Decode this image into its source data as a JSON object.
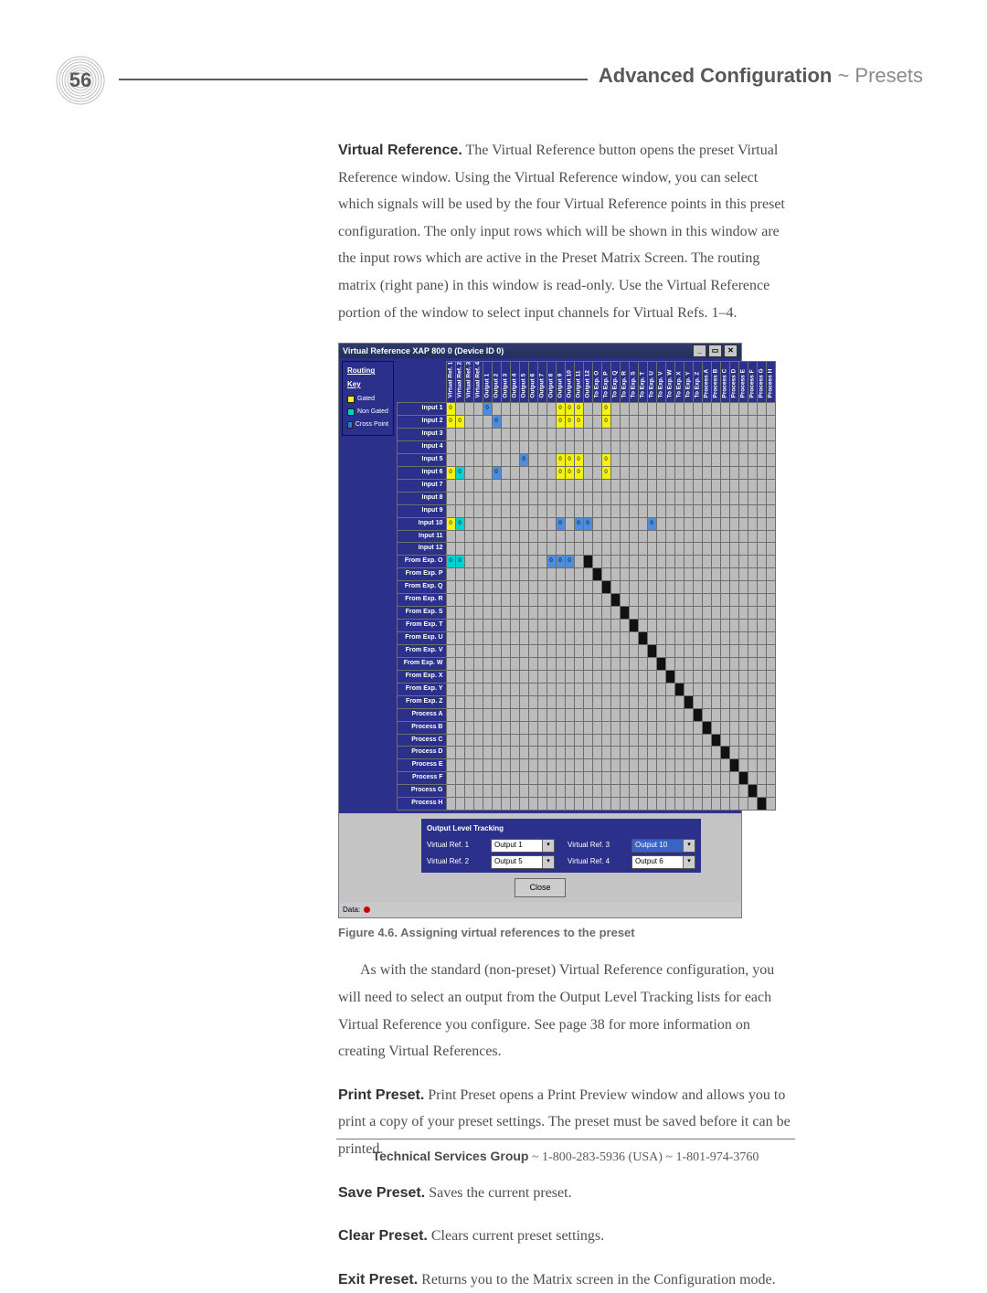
{
  "pageNumber": "56",
  "header": {
    "strong": "Advanced Configuration",
    "sep": " ~ ",
    "light": "Presets"
  },
  "p1": {
    "lead": "Virtual Reference.",
    "text": " The Virtual Reference button opens the preset Virtual Reference window. Using the Virtual Reference window, you can select which signals will be used by the four Virtual Reference points in this preset configuration. The only input rows which will be shown in this window are the input rows which are active in the Preset Matrix Screen. The routing matrix (right pane) in this window is read-only. Use the Virtual Reference portion of the window to select input channels for Virtual Refs. 1–4."
  },
  "screenshot": {
    "title": "Virtual Reference XAP 800 0 (Device ID 0)",
    "legend": {
      "title": "Routing Key",
      "items": [
        "Gated",
        "Non Gated",
        "Cross Point"
      ]
    },
    "cols": [
      "Virtual Ref. 1",
      "Virtual Ref. 2",
      "Virtual Ref. 3",
      "Virtual Ref. 4",
      "Output 1",
      "Output 2",
      "Output 3",
      "Output 4",
      "Output 5",
      "Output 6",
      "Output 7",
      "Output 8",
      "Output 9",
      "Output 10",
      "Output 11",
      "Output 12",
      "To Exp. O",
      "To Exp. P",
      "To Exp. Q",
      "To Exp. R",
      "To Exp. S",
      "To Exp. T",
      "To Exp. U",
      "To Exp. V",
      "To Exp. W",
      "To Exp. X",
      "To Exp. Y",
      "To Exp. Z",
      "Process A",
      "Process B",
      "Process C",
      "Process D",
      "Process E",
      "Process F",
      "Process G",
      "Process H"
    ],
    "rows": [
      "Input 1",
      "Input 2",
      "Input 3",
      "Input 4",
      "Input 5",
      "Input 6",
      "Input 7",
      "Input 8",
      "Input 9",
      "Input 10",
      "Input 11",
      "Input 12",
      "From Exp. O",
      "From Exp. P",
      "From Exp. Q",
      "From Exp. R",
      "From Exp. S",
      "From Exp. T",
      "From Exp. U",
      "From Exp. V",
      "From Exp. W",
      "From Exp. X",
      "From Exp. Y",
      "From Exp. Z",
      "Process A",
      "Process B",
      "Process C",
      "Process D",
      "Process E",
      "Process F",
      "Process G",
      "Process H"
    ],
    "marks": {
      "Input 1": {
        "0": "y",
        "4": "b",
        "12": "y",
        "13": "y",
        "14": "y",
        "17": "y"
      },
      "Input 2": {
        "0": "y",
        "1": "y",
        "5": "b",
        "12": "y",
        "13": "y",
        "14": "y",
        "17": "y"
      },
      "Input 5": {
        "8": "b",
        "12": "y",
        "13": "y",
        "14": "y",
        "17": "y"
      },
      "Input 6": {
        "0": "y",
        "1": "g",
        "5": "b",
        "12": "y",
        "13": "y",
        "14": "y",
        "17": "y"
      },
      "Input 10": {
        "0": "y",
        "1": "g",
        "12": "b",
        "14": "b",
        "15": "b",
        "22": "b"
      },
      "From Exp. O": {
        "0": "g",
        "1": "g",
        "11": "b",
        "12": "b",
        "13": "b"
      }
    },
    "diagRow0": "From Exp. O",
    "diagCol0": 15,
    "olt": {
      "title": "Output Level Tracking",
      "vr1_label": "Virtual Ref. 1",
      "vr1_value": "Output 1",
      "vr2_label": "Virtual Ref. 2",
      "vr2_value": "Output 5",
      "vr3_label": "Virtual Ref. 3",
      "vr3_value": "Output 10",
      "vr4_label": "Virtual Ref. 4",
      "vr4_value": "Output 6"
    },
    "close": "Close",
    "status": "Data:"
  },
  "caption": "Figure 4.6. Assigning virtual references to the preset",
  "p2": "As with the standard (non-preset) Virtual Reference configuration, you will need to select an output from the Output Level Tracking lists for each Virtual Reference you configure. See page 38 for more information on creating Virtual References.",
  "p3": {
    "lead": "Print Preset.",
    "text": " Print Preset opens a Print Preview window and allows you to print a copy of your preset settings. The preset must be saved before it can be printed."
  },
  "p4": {
    "lead": "Save Preset.",
    "text": " Saves the current preset."
  },
  "p5": {
    "lead": "Clear Preset.",
    "text": " Clears current preset settings."
  },
  "p6": {
    "lead": "Exit Preset.",
    "text": " Returns you to the Matrix screen in the Configuration mode."
  },
  "footer": {
    "strong": "Technical Services Group",
    "rest": " ~ 1-800-283-5936 (USA) ~ 1-801-974-3760"
  }
}
